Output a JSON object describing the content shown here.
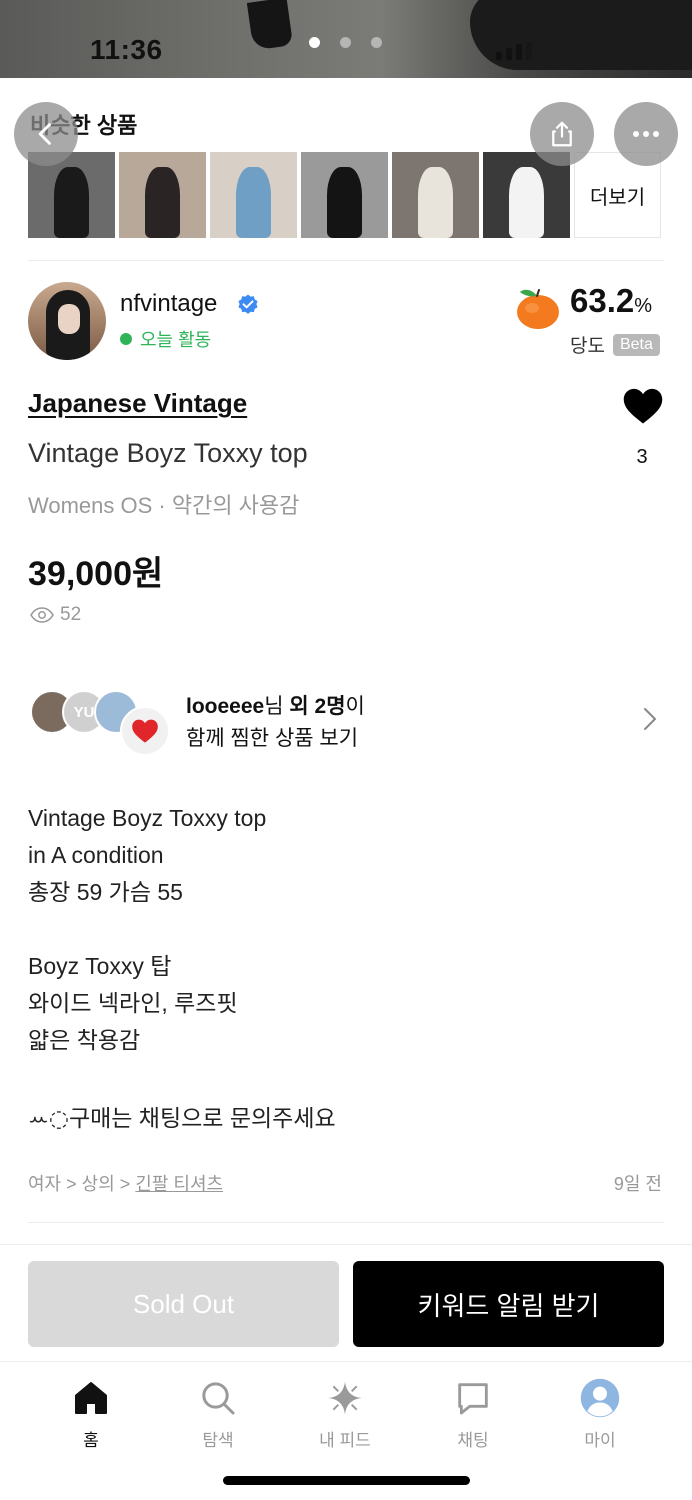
{
  "status_bar": {
    "time": "11:36"
  },
  "carousel": {
    "pages": 3,
    "active_page": 1
  },
  "similar": {
    "title": "비슷한 상품",
    "more_label": "더보기",
    "thumb_colors": [
      "#6b6b6b",
      "#5a5050",
      "#8fb4cf",
      "#9a9a9a",
      "#c9c2b8",
      "#e9e9e9"
    ]
  },
  "seller": {
    "name": "nfvintage",
    "activity": "오늘 활동",
    "score": "63.2",
    "score_unit": "%",
    "score_label": "당도",
    "badge": "Beta"
  },
  "product": {
    "brand": "Japanese Vintage",
    "title": "Vintage Boyz Toxxy top",
    "meta": "Womens OS · 약간의 사용감",
    "price": "39,000원",
    "views": "52",
    "likes": "3"
  },
  "liked_by": {
    "name": "looeeee",
    "suffix1": "님 ",
    "bold": "외 2명",
    "suffix2": "이",
    "line2": "함께 찜한 상품 보기",
    "avatar2_initials": "YU"
  },
  "description": {
    "lines": [
      "Vintage Boyz Toxxy top",
      "in A condition",
      "총장 59 가슴 55",
      "",
      "Boyz Toxxy 탑",
      "와이드 넥라인, 루즈핏",
      "얇은 착용감",
      "",
      "구매는 채팅으로 문의주세요"
    ],
    "swirl": "ꕀ◌"
  },
  "category": {
    "path1": "여자",
    "path2": "상의",
    "leaf": "긴팔 티셔츠",
    "sep": " > ",
    "posted": "9일 전"
  },
  "actions": {
    "sold_out": "Sold Out",
    "keyword_alert": "키워드 알림 받기"
  },
  "tabs": [
    {
      "label": "홈",
      "icon": "home-icon",
      "active": true
    },
    {
      "label": "탐색",
      "icon": "search-icon",
      "active": false
    },
    {
      "label": "내 피드",
      "icon": "sparkle-icon",
      "active": false
    },
    {
      "label": "채팅",
      "icon": "chat-icon",
      "active": false
    },
    {
      "label": "마이",
      "icon": "profile-icon",
      "active": false
    }
  ],
  "colors": {
    "accent_green": "#2fb45a",
    "verified_blue": "#3d8bf2",
    "heart_red": "#e0262b",
    "peach": "#f47a1f"
  }
}
